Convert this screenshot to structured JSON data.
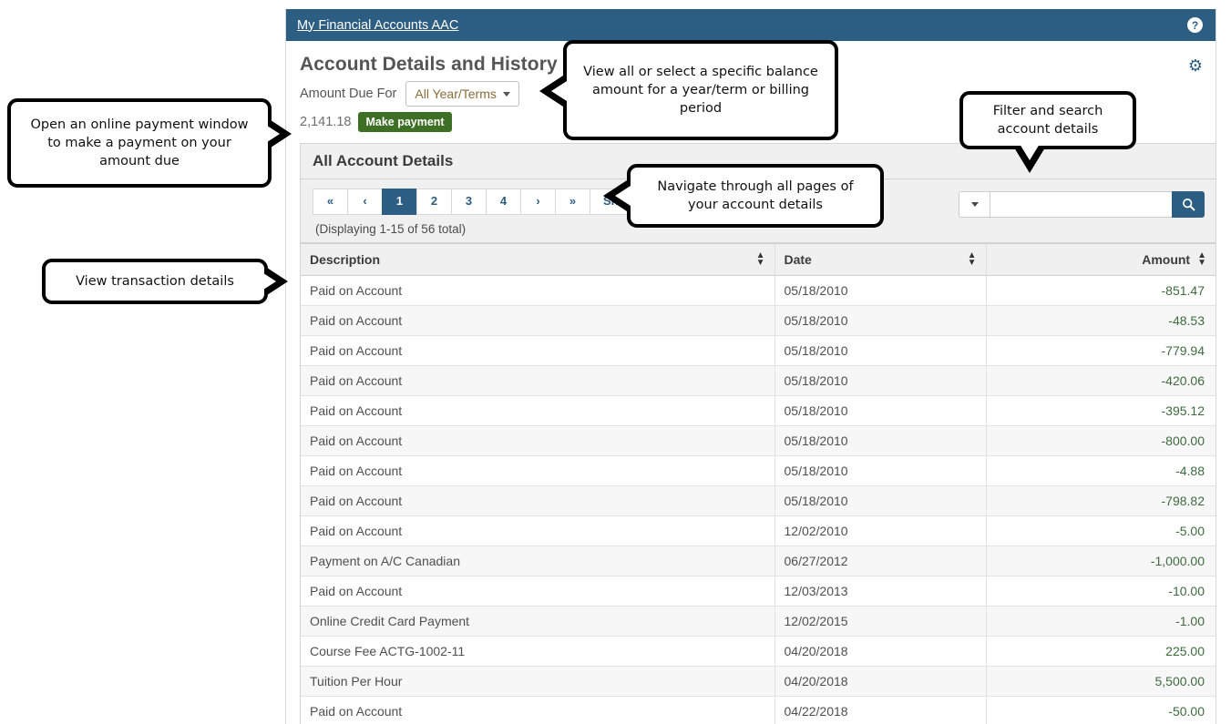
{
  "app": {
    "header_title": "My Financial Accounts AAC",
    "help_icon": "question-circle-icon",
    "gear_icon": "gear-icon",
    "header_color": "#2c5d82"
  },
  "page": {
    "title": "Account Details and History",
    "amount_due_label": "Amount Due For",
    "term_select_value": "All Year/Terms",
    "amount_value": "2,141.18",
    "make_payment_label": "Make payment",
    "make_payment_color": "#3d7024"
  },
  "card": {
    "heading": "All Account Details",
    "pagination": [
      {
        "label": "«",
        "name": "page-first",
        "active": false
      },
      {
        "label": "‹",
        "name": "page-prev",
        "active": false
      },
      {
        "label": "1",
        "name": "page-1",
        "active": true
      },
      {
        "label": "2",
        "name": "page-2",
        "active": false
      },
      {
        "label": "3",
        "name": "page-3",
        "active": false
      },
      {
        "label": "4",
        "name": "page-4",
        "active": false
      },
      {
        "label": "›",
        "name": "page-next",
        "active": false
      },
      {
        "label": "»",
        "name": "page-last",
        "active": false
      },
      {
        "label": "Show All",
        "name": "page-show-all",
        "active": false
      }
    ],
    "displaying_text": "(Displaying 1-15 of 56 total)",
    "search_placeholder": "",
    "search_value": "",
    "search_icon": "search-icon",
    "filter_caret_icon": "chevron-down-icon"
  },
  "table": {
    "columns": [
      {
        "label": "Description",
        "align": "left"
      },
      {
        "label": "Date",
        "align": "left"
      },
      {
        "label": "Amount",
        "align": "right"
      }
    ],
    "sort_icon": "sort-updown-icon",
    "rows": [
      {
        "description": "Paid on Account",
        "date": "05/18/2010",
        "amount": "-851.47"
      },
      {
        "description": "Paid on Account",
        "date": "05/18/2010",
        "amount": "-48.53"
      },
      {
        "description": "Paid on Account",
        "date": "05/18/2010",
        "amount": "-779.94"
      },
      {
        "description": "Paid on Account",
        "date": "05/18/2010",
        "amount": "-420.06"
      },
      {
        "description": "Paid on Account",
        "date": "05/18/2010",
        "amount": "-395.12"
      },
      {
        "description": "Paid on Account",
        "date": "05/18/2010",
        "amount": "-800.00"
      },
      {
        "description": "Paid on Account",
        "date": "05/18/2010",
        "amount": "-4.88"
      },
      {
        "description": "Paid on Account",
        "date": "05/18/2010",
        "amount": "-798.82"
      },
      {
        "description": "Paid on Account",
        "date": "12/02/2010",
        "amount": "-5.00"
      },
      {
        "description": "Payment on A/C Canadian",
        "date": "06/27/2012",
        "amount": "-1,000.00"
      },
      {
        "description": "Paid on Account",
        "date": "12/03/2013",
        "amount": "-10.00"
      },
      {
        "description": "Online Credit Card Payment",
        "date": "12/02/2015",
        "amount": "-1.00"
      },
      {
        "description": "Course Fee ACTG-1002-11",
        "date": "04/20/2018",
        "amount": "225.00"
      },
      {
        "description": "Tuition Per Hour",
        "date": "04/20/2018",
        "amount": "5,500.00"
      },
      {
        "description": "Paid on Account",
        "date": "04/22/2018",
        "amount": "-50.00"
      }
    ]
  },
  "callouts": {
    "payment": "Open an online payment window to make a payment on your amount due",
    "transaction": "View transaction details",
    "term": "View all or select a specific balance amount for a year/term or billing period",
    "navigate": "Navigate through all pages of your account details",
    "filter": "Filter and search account details"
  }
}
